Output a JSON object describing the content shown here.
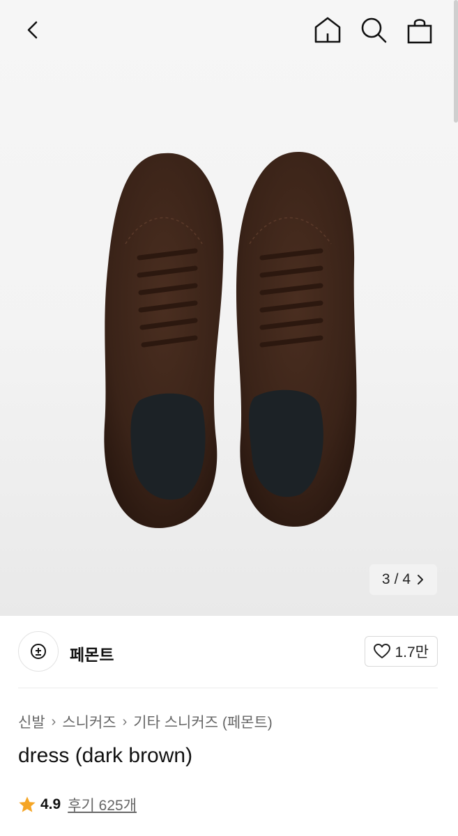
{
  "gallery": {
    "current": "3",
    "separator": "/",
    "total": "4",
    "image_alt": "dress (dark brown) shoes top view"
  },
  "brand": {
    "name": "페몬트"
  },
  "like": {
    "count": "1.7만"
  },
  "breadcrumb": {
    "items": [
      "신발",
      "스니커즈",
      "기타 스니커즈 (페몬트)"
    ]
  },
  "product": {
    "title": "dress (dark brown)"
  },
  "rating": {
    "score": "4.9",
    "reviews": "후기 625개"
  },
  "colors": {
    "star": "#f5a524",
    "shoe": "#3a2418"
  },
  "icons": [
    "chevron-left-icon",
    "home-icon",
    "search-icon",
    "shopping-bag-icon",
    "chevron-right-icon",
    "heart-icon",
    "star-icon"
  ]
}
